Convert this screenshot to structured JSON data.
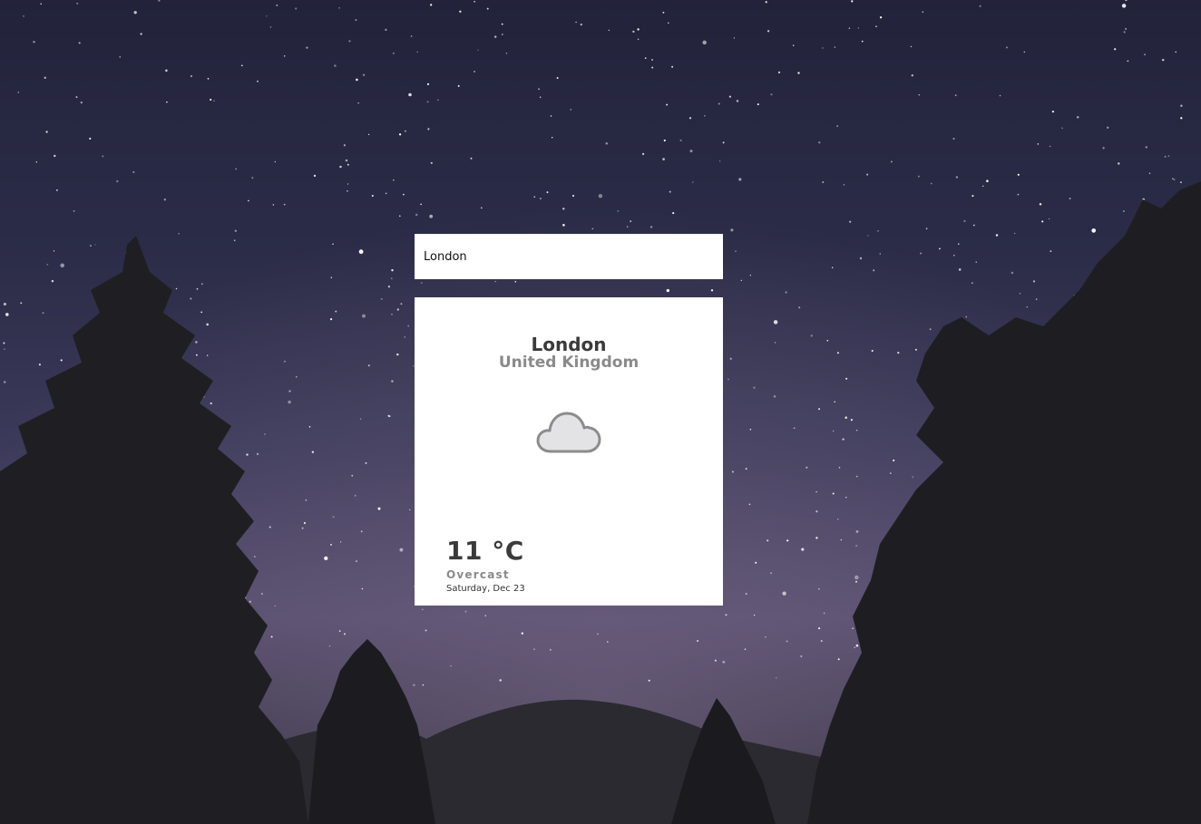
{
  "search": {
    "value": "London",
    "placeholder": ""
  },
  "weather": {
    "city": "London",
    "country": "United Kingdom",
    "icon": "cloud-icon",
    "temperature": "11 °C",
    "condition": "Overcast",
    "date": "Saturday, Dec 23"
  },
  "colors": {
    "card_background": "#ffffff",
    "primary_text": "#3a3a3a",
    "secondary_text": "#8a8a8a"
  }
}
